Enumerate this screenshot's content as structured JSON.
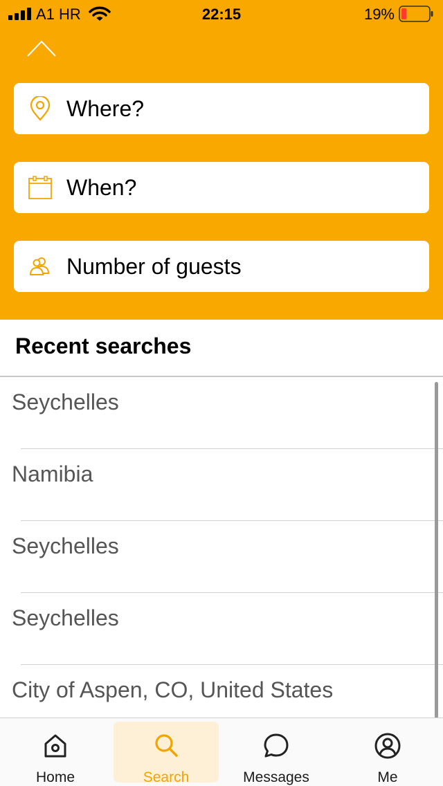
{
  "status_bar": {
    "carrier": "A1 HR",
    "time": "22:15",
    "battery_percent": "19%",
    "battery_level": 0.19
  },
  "search_form": {
    "where": {
      "label": "Where?",
      "icon": "location-pin-icon"
    },
    "when": {
      "label": "When?",
      "icon": "calendar-icon"
    },
    "guests": {
      "label": "Number of guests",
      "icon": "guests-icon"
    }
  },
  "recent": {
    "title": "Recent searches",
    "items": [
      "Seychelles",
      "Namibia",
      "Seychelles",
      "Seychelles",
      "City of Aspen, CO, United States"
    ]
  },
  "tabs": [
    {
      "label": "Home",
      "icon": "home-icon",
      "active": false
    },
    {
      "label": "Search",
      "icon": "search-icon",
      "active": true
    },
    {
      "label": "Messages",
      "icon": "chat-bubble-icon",
      "active": false
    },
    {
      "label": "Me",
      "icon": "profile-icon",
      "active": false
    }
  ],
  "colors": {
    "accent": "#f9a800",
    "active_tab_bg": "#fdf0d6",
    "battery_low": "#ff3b30"
  }
}
